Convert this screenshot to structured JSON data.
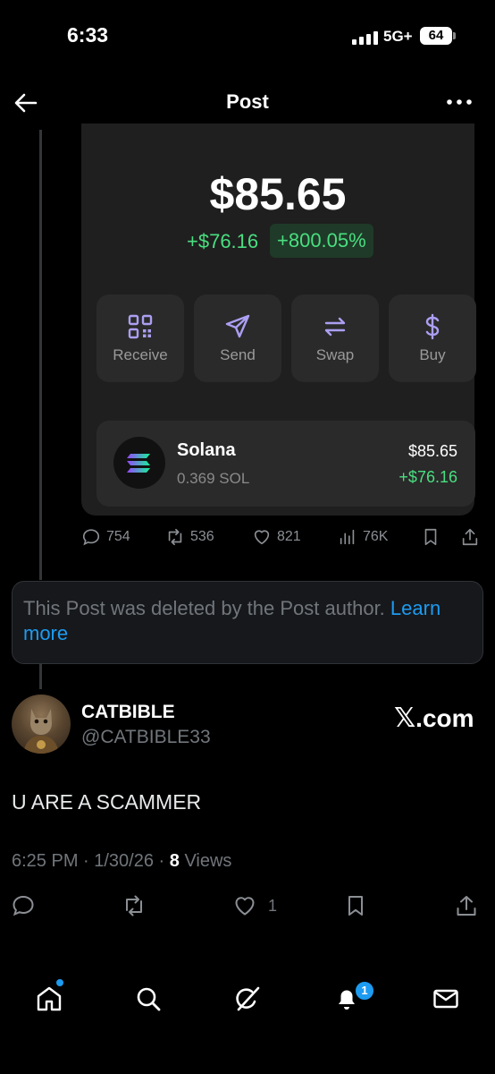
{
  "status_bar": {
    "time": "6:33",
    "network": "5G+",
    "battery": "64"
  },
  "header": {
    "title": "Post"
  },
  "wallet_card": {
    "balance": "$85.65",
    "change_amount": "+$76.16",
    "change_percent": "+800.05%",
    "actions": [
      {
        "label": "Receive",
        "icon": "qr-code-icon"
      },
      {
        "label": "Send",
        "icon": "send-icon"
      },
      {
        "label": "Swap",
        "icon": "swap-icon"
      },
      {
        "label": "Buy",
        "icon": "dollar-icon"
      }
    ],
    "token": {
      "name": "Solana",
      "amount": "0.369 SOL",
      "value": "$85.65",
      "change": "+$76.16"
    }
  },
  "metrics": {
    "replies": "754",
    "reposts": "536",
    "likes": "821",
    "views": "76K"
  },
  "deleted_notice": {
    "text": "This Post was deleted by the Post author. ",
    "link": "Learn more"
  },
  "reply": {
    "name": "CATBIBLE",
    "handle": "@CATBIBLE33",
    "source": ".com",
    "source_logo": "𝕏",
    "text": "U ARE A SCAMMER",
    "time_date": "6:25 PM · 1/30/26 · ",
    "views_count": "8",
    "views_label": " Views",
    "like_count": "1"
  },
  "bottom_nav": {
    "notifications_badge": "1"
  },
  "colors": {
    "accent": "#1d9bf0",
    "positive": "#4ade80"
  }
}
